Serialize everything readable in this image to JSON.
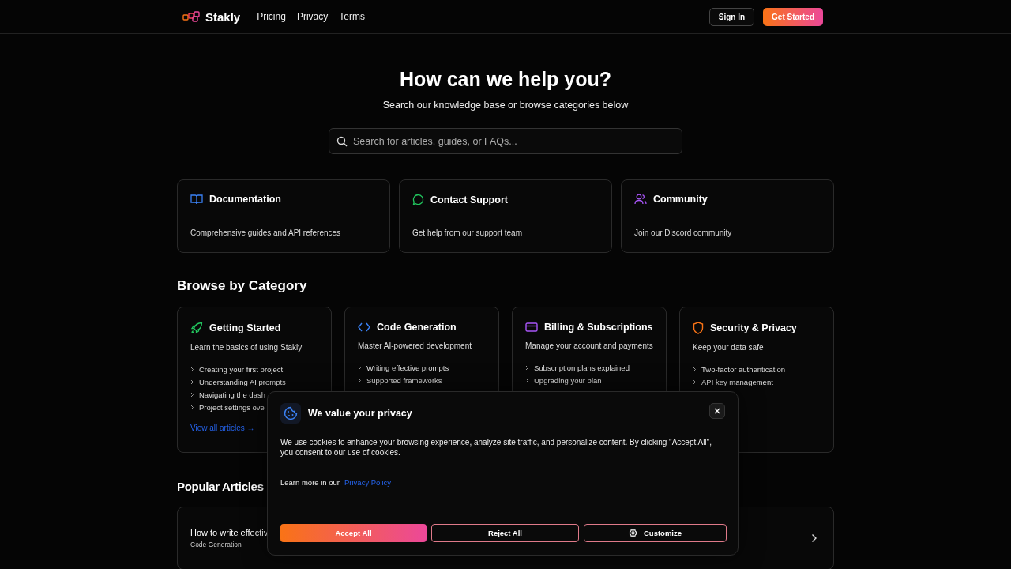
{
  "nav": {
    "brand": "Stakly",
    "links": [
      "Pricing",
      "Privacy",
      "Terms"
    ],
    "sign_in": "Sign In",
    "get_started": "Get Started"
  },
  "hero": {
    "title": "How can we help you?",
    "subtitle": "Search our knowledge base or browse categories below",
    "search": {
      "placeholder": "Search for articles, guides, or FAQs..."
    }
  },
  "quick_links": [
    {
      "kind": "book",
      "title": "Documentation",
      "description": "Comprehensive guides and API references"
    },
    {
      "kind": "chat",
      "title": "Contact Support",
      "description": "Get help from our support team"
    },
    {
      "kind": "people",
      "title": "Community",
      "description": "Join our Discord community"
    }
  ],
  "categories_heading": "Browse by Category",
  "categories": [
    {
      "kind": "rocket",
      "title": "Getting Started",
      "description": "Learn the basics of using Stakly",
      "articles": [
        "Creating your first project",
        "Understanding AI prompts",
        "Navigating the dash",
        "Project settings ove"
      ],
      "link": "View all articles →"
    },
    {
      "kind": "code",
      "title": "Code Generation",
      "description": "Master AI-powered development",
      "articles": [
        "Writing effective prompts",
        "Supported frameworks"
      ]
    },
    {
      "kind": "card",
      "title": "Billing & Subscriptions",
      "description": "Manage your account and payments",
      "articles": [
        "Subscription plans explained",
        "Upgrading your plan"
      ]
    },
    {
      "kind": "shield",
      "title": "Security & Privacy",
      "description": "Keep your data safe",
      "articles": [
        "Two-factor authentication",
        "API key management"
      ]
    }
  ],
  "popular_heading": "Popular Articles",
  "popular_articles": [
    {
      "title": "How to write effectiv",
      "category": "Code Generation",
      "separator": "·"
    }
  ],
  "cookie_banner": {
    "title": "We value your privacy",
    "text": "We use cookies to enhance your browsing experience, analyze site traffic, and personalize content. By clicking \"Accept All\", you consent to our use of cookies.",
    "learn_more": "Learn more in our",
    "policy_link": "Privacy Policy",
    "accept": "Accept All",
    "reject": "Reject All",
    "customize": "Customize"
  }
}
